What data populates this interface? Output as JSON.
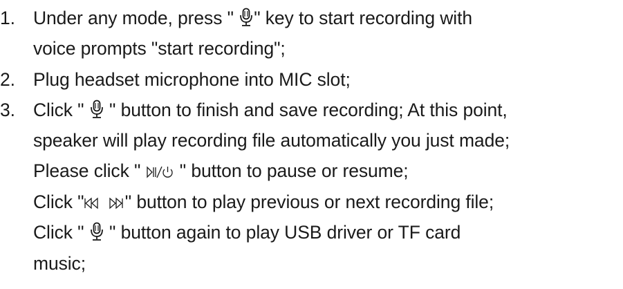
{
  "instructions": [
    {
      "number": "1.",
      "lines": [
        [
          "Under any mode, press \" ",
          {
            "icon": "microphone-icon"
          },
          "\" key to start recording with"
        ],
        [
          "voice prompts \"start recording\";"
        ]
      ]
    },
    {
      "number": "2.",
      "lines": [
        [
          "Plug headset microphone into MIC slot;"
        ]
      ]
    },
    {
      "number": "3.",
      "lines": [
        [
          "Click \" ",
          {
            "icon": "microphone-icon"
          },
          " \" button to finish and save recording; At this point,"
        ],
        [
          "speaker will play recording file automatically you just made;"
        ],
        [
          "Please click \" ",
          {
            "icon": "play-pause-power-icon"
          },
          " \" button to pause or resume;"
        ],
        [
          "Click \"",
          {
            "icon": "previous-track-icon"
          },
          " ",
          {
            "icon": "next-track-icon"
          },
          "\" button to play previous or next recording file;"
        ],
        [
          "Click \"  ",
          {
            "icon": "microphone-icon"
          },
          "  \" button again to play USB driver or TF card"
        ],
        [
          "music;"
        ]
      ]
    }
  ]
}
